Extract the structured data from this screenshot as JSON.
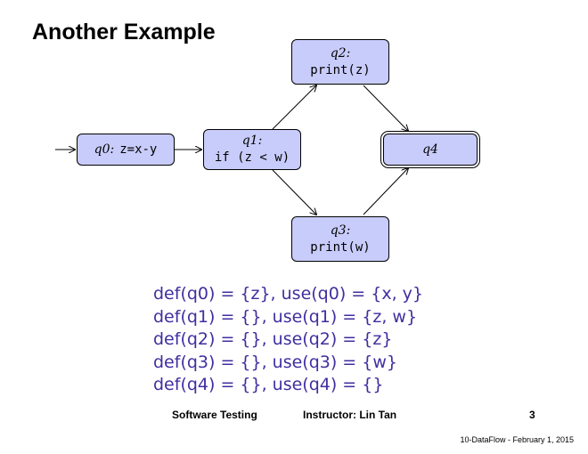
{
  "title": "Another Example",
  "nodes": {
    "q0": {
      "state": "q0:",
      "code": "z=x-y"
    },
    "q1": {
      "state": "q1:",
      "code": "if (z < w)"
    },
    "q2": {
      "state": "q2:",
      "code": "print(z)"
    },
    "q3": {
      "state": "q3:",
      "code": "print(w)"
    },
    "q4": {
      "state": "q4"
    }
  },
  "defs": [
    "def(q0) = {z}, use(q0) = {x, y}",
    "def(q1) = {}, use(q1) = {z, w}",
    "def(q2) = {}, use(q2) = {z}",
    "def(q3) = {}, use(q3) = {w}",
    "def(q4) = {}, use(q4) = {}"
  ],
  "footer": {
    "course": "Software Testing",
    "instructor": "Instructor: Lin Tan",
    "page": "3",
    "stamp": "10-DataFlow - February 1, 2015"
  },
  "colors": {
    "node_fill": "#c8ccfa",
    "defs_text": "#3f2fa0"
  }
}
